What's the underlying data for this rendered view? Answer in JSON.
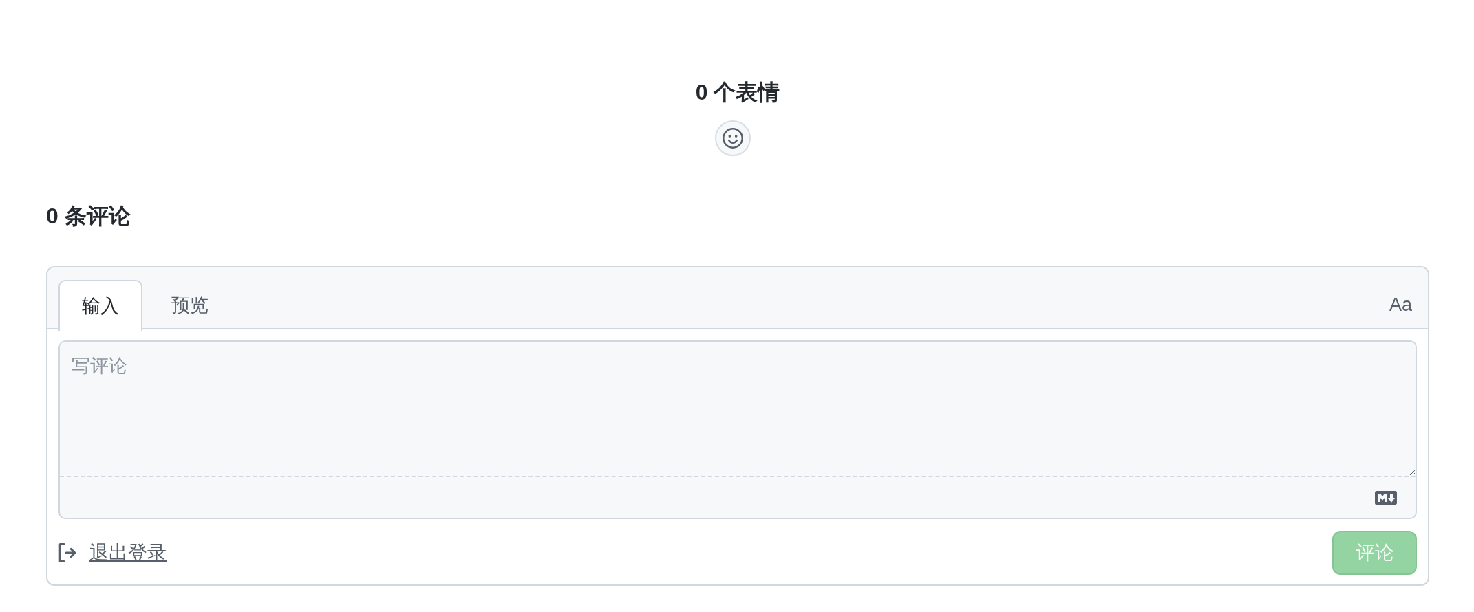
{
  "reactions": {
    "title": "0 个表情"
  },
  "comments": {
    "heading": "0 条评论"
  },
  "editor": {
    "tabs": [
      {
        "label": "输入",
        "selected": true
      },
      {
        "label": "预览",
        "selected": false
      }
    ],
    "font_toggle": "Aa",
    "input": {
      "placeholder": "写评论"
    }
  },
  "footer": {
    "logout_link": "退出登录",
    "submit": {
      "label": "评论",
      "disabled": true
    }
  }
}
